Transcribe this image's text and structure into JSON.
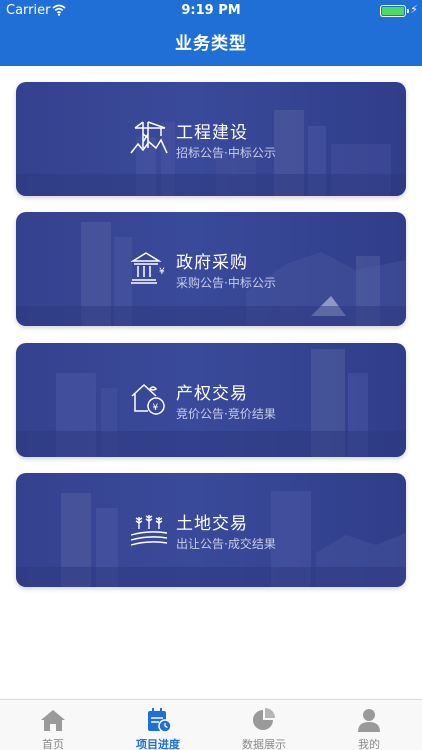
{
  "status_bar": {
    "carrier": "Carrier",
    "time": "9:19 PM"
  },
  "header": {
    "title": "业务类型"
  },
  "cards": [
    {
      "title": "工程建设",
      "subtitle": "招标公告·中标公示",
      "icon": "construction-crane-icon"
    },
    {
      "title": "政府采购",
      "subtitle": "采购公告·中标公示",
      "icon": "government-building-icon"
    },
    {
      "title": "产权交易",
      "subtitle": "竞价公告·竞价结果",
      "icon": "house-money-icon"
    },
    {
      "title": "土地交易",
      "subtitle": "出让公告·成交结果",
      "icon": "farmland-icon"
    }
  ],
  "tabs": [
    {
      "label": "首页",
      "icon": "home-icon",
      "active": false
    },
    {
      "label": "项目进度",
      "icon": "calendar-clock-icon",
      "active": true
    },
    {
      "label": "数据展示",
      "icon": "pie-chart-icon",
      "active": false
    },
    {
      "label": "我的",
      "icon": "user-icon",
      "active": false
    }
  ],
  "colors": {
    "accent": "#1f6fd6",
    "card_bg": "#34418f",
    "tab_inactive": "#8a8a8a"
  }
}
